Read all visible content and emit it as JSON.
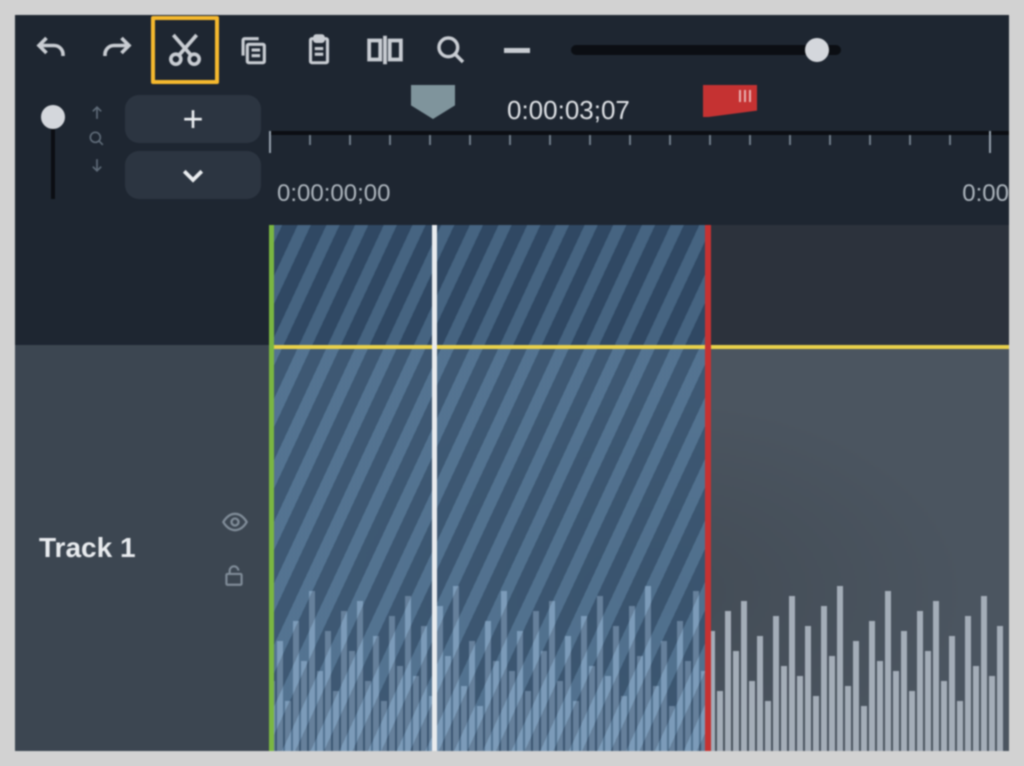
{
  "toolbar": {
    "undo": "undo",
    "redo": "redo",
    "cut": "cut",
    "copy": "copy",
    "paste": "paste",
    "split": "split",
    "zoom": "zoom",
    "zoom_out": "zoom-out",
    "zoom_level": 0.9
  },
  "controls": {
    "add_track": "+",
    "expand": "expand"
  },
  "ruler": {
    "playhead_time": "0:00:03;07",
    "start_time": "0:00:00;00",
    "right_time": "0:00"
  },
  "tracks": [
    {
      "name": "Track 1",
      "visible": true,
      "locked": false
    }
  ],
  "colors": {
    "highlight": "#f5b82e",
    "marker_red": "#c53232",
    "clip_start_green": "#7ab642",
    "selection_blue": "#4f7fae",
    "audio_yellow": "#e8d04a"
  }
}
